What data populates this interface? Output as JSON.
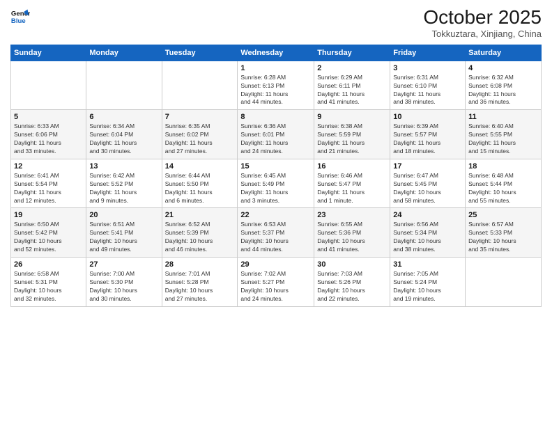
{
  "logo": {
    "line1": "General",
    "line2": "Blue"
  },
  "title": "October 2025",
  "location": "Tokkuztara, Xinjiang, China",
  "days_of_week": [
    "Sunday",
    "Monday",
    "Tuesday",
    "Wednesday",
    "Thursday",
    "Friday",
    "Saturday"
  ],
  "weeks": [
    [
      {
        "day": "",
        "info": ""
      },
      {
        "day": "",
        "info": ""
      },
      {
        "day": "",
        "info": ""
      },
      {
        "day": "1",
        "info": "Sunrise: 6:28 AM\nSunset: 6:13 PM\nDaylight: 11 hours\nand 44 minutes."
      },
      {
        "day": "2",
        "info": "Sunrise: 6:29 AM\nSunset: 6:11 PM\nDaylight: 11 hours\nand 41 minutes."
      },
      {
        "day": "3",
        "info": "Sunrise: 6:31 AM\nSunset: 6:10 PM\nDaylight: 11 hours\nand 38 minutes."
      },
      {
        "day": "4",
        "info": "Sunrise: 6:32 AM\nSunset: 6:08 PM\nDaylight: 11 hours\nand 36 minutes."
      }
    ],
    [
      {
        "day": "5",
        "info": "Sunrise: 6:33 AM\nSunset: 6:06 PM\nDaylight: 11 hours\nand 33 minutes."
      },
      {
        "day": "6",
        "info": "Sunrise: 6:34 AM\nSunset: 6:04 PM\nDaylight: 11 hours\nand 30 minutes."
      },
      {
        "day": "7",
        "info": "Sunrise: 6:35 AM\nSunset: 6:02 PM\nDaylight: 11 hours\nand 27 minutes."
      },
      {
        "day": "8",
        "info": "Sunrise: 6:36 AM\nSunset: 6:01 PM\nDaylight: 11 hours\nand 24 minutes."
      },
      {
        "day": "9",
        "info": "Sunrise: 6:38 AM\nSunset: 5:59 PM\nDaylight: 11 hours\nand 21 minutes."
      },
      {
        "day": "10",
        "info": "Sunrise: 6:39 AM\nSunset: 5:57 PM\nDaylight: 11 hours\nand 18 minutes."
      },
      {
        "day": "11",
        "info": "Sunrise: 6:40 AM\nSunset: 5:55 PM\nDaylight: 11 hours\nand 15 minutes."
      }
    ],
    [
      {
        "day": "12",
        "info": "Sunrise: 6:41 AM\nSunset: 5:54 PM\nDaylight: 11 hours\nand 12 minutes."
      },
      {
        "day": "13",
        "info": "Sunrise: 6:42 AM\nSunset: 5:52 PM\nDaylight: 11 hours\nand 9 minutes."
      },
      {
        "day": "14",
        "info": "Sunrise: 6:44 AM\nSunset: 5:50 PM\nDaylight: 11 hours\nand 6 minutes."
      },
      {
        "day": "15",
        "info": "Sunrise: 6:45 AM\nSunset: 5:49 PM\nDaylight: 11 hours\nand 3 minutes."
      },
      {
        "day": "16",
        "info": "Sunrise: 6:46 AM\nSunset: 5:47 PM\nDaylight: 11 hours\nand 1 minute."
      },
      {
        "day": "17",
        "info": "Sunrise: 6:47 AM\nSunset: 5:45 PM\nDaylight: 10 hours\nand 58 minutes."
      },
      {
        "day": "18",
        "info": "Sunrise: 6:48 AM\nSunset: 5:44 PM\nDaylight: 10 hours\nand 55 minutes."
      }
    ],
    [
      {
        "day": "19",
        "info": "Sunrise: 6:50 AM\nSunset: 5:42 PM\nDaylight: 10 hours\nand 52 minutes."
      },
      {
        "day": "20",
        "info": "Sunrise: 6:51 AM\nSunset: 5:41 PM\nDaylight: 10 hours\nand 49 minutes."
      },
      {
        "day": "21",
        "info": "Sunrise: 6:52 AM\nSunset: 5:39 PM\nDaylight: 10 hours\nand 46 minutes."
      },
      {
        "day": "22",
        "info": "Sunrise: 6:53 AM\nSunset: 5:37 PM\nDaylight: 10 hours\nand 44 minutes."
      },
      {
        "day": "23",
        "info": "Sunrise: 6:55 AM\nSunset: 5:36 PM\nDaylight: 10 hours\nand 41 minutes."
      },
      {
        "day": "24",
        "info": "Sunrise: 6:56 AM\nSunset: 5:34 PM\nDaylight: 10 hours\nand 38 minutes."
      },
      {
        "day": "25",
        "info": "Sunrise: 6:57 AM\nSunset: 5:33 PM\nDaylight: 10 hours\nand 35 minutes."
      }
    ],
    [
      {
        "day": "26",
        "info": "Sunrise: 6:58 AM\nSunset: 5:31 PM\nDaylight: 10 hours\nand 32 minutes."
      },
      {
        "day": "27",
        "info": "Sunrise: 7:00 AM\nSunset: 5:30 PM\nDaylight: 10 hours\nand 30 minutes."
      },
      {
        "day": "28",
        "info": "Sunrise: 7:01 AM\nSunset: 5:28 PM\nDaylight: 10 hours\nand 27 minutes."
      },
      {
        "day": "29",
        "info": "Sunrise: 7:02 AM\nSunset: 5:27 PM\nDaylight: 10 hours\nand 24 minutes."
      },
      {
        "day": "30",
        "info": "Sunrise: 7:03 AM\nSunset: 5:26 PM\nDaylight: 10 hours\nand 22 minutes."
      },
      {
        "day": "31",
        "info": "Sunrise: 7:05 AM\nSunset: 5:24 PM\nDaylight: 10 hours\nand 19 minutes."
      },
      {
        "day": "",
        "info": ""
      }
    ]
  ]
}
